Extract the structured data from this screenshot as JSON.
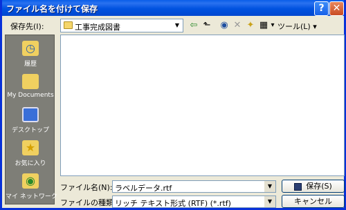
{
  "window": {
    "title": "ファイル名を付けて保存",
    "help": "?",
    "close": "✕"
  },
  "lookin": {
    "label": "保存先(I):",
    "value": "工事完成図書",
    "arrow": "▼"
  },
  "toolbar": {
    "back": "⇦",
    "up": "⬑",
    "search": "◉",
    "delete": "✕",
    "new_folder": "✦",
    "views": "▦",
    "views_arrow": "▾",
    "tools": "ツール(L) ▾"
  },
  "places": [
    {
      "label": "履歴",
      "icon": "history-icon"
    },
    {
      "label": "My Documents",
      "icon": "my-documents-icon"
    },
    {
      "label": "デスクトップ",
      "icon": "desktop-icon"
    },
    {
      "label": "お気に入り",
      "icon": "favorites-icon"
    },
    {
      "label": "マイ ネットワーク",
      "icon": "network-icon"
    }
  ],
  "filename": {
    "label": "ファイル名(N):",
    "value": "ラベルデータ.rtf",
    "arrow": "▼"
  },
  "filetype": {
    "label": "ファイルの種類(T):",
    "value": "リッチ テキスト形式 (RTF) (*.rtf)",
    "arrow": "▼"
  },
  "buttons": {
    "save": "保存(S)",
    "cancel": "キャンセル"
  }
}
